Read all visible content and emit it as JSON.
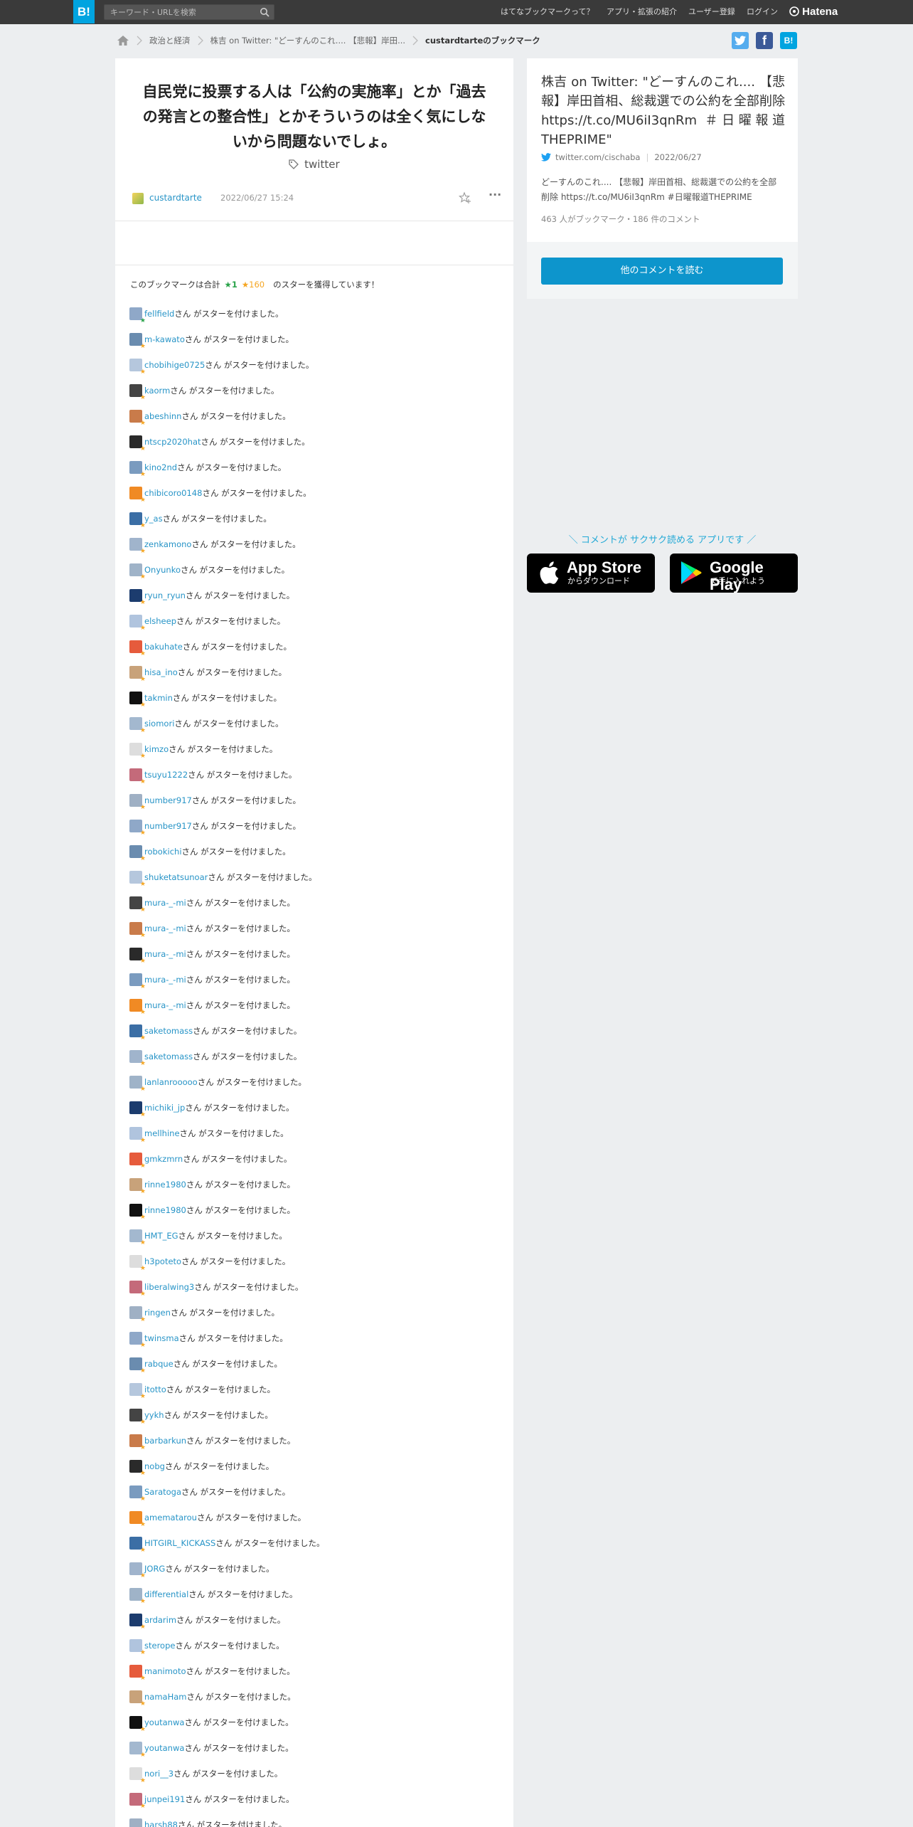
{
  "header": {
    "logo": "B!",
    "search_placeholder": "キーワード・URLを検索",
    "nav": [
      "はてなブックマークって？",
      "アプリ・拡張の紹介",
      "ユーザー登録",
      "ログイン"
    ],
    "brand": "Hatena"
  },
  "breadcrumb": {
    "items": [
      "政治と経済",
      "株吉 on Twitter: \"どーすんのこれ.... 【悲報】岸田...",
      "custardtarteのブックマーク"
    ]
  },
  "share": {
    "twitter": "twitter",
    "facebook": "f",
    "hatena": "B!"
  },
  "bookmark": {
    "comment": "自民党に投票する人は「公約の実施率」とか「過去の発言との整合性」とかそういうのは全く気にしないから問題ないでしょ。",
    "tag": "twitter",
    "user": "custardtarte",
    "date": "2022/06/27 15:24",
    "star_total_prefix": "このブックマークは合計",
    "green_stars": "1",
    "yellow_stars": "160",
    "star_total_suffix": "のスターを獲得しています！"
  },
  "star_suffix": "さん がスターを付けました。",
  "stars": [
    {
      "user": "fellfield",
      "green": true
    },
    {
      "user": "m-kawato"
    },
    {
      "user": "chobihige0725"
    },
    {
      "user": "kaorm"
    },
    {
      "user": "abeshinn"
    },
    {
      "user": "ntscp2020hat"
    },
    {
      "user": "kino2nd"
    },
    {
      "user": "chibicoro0148"
    },
    {
      "user": "y_as"
    },
    {
      "user": "zenkamono"
    },
    {
      "user": "Onyunko"
    },
    {
      "user": "ryun_ryun"
    },
    {
      "user": "elsheep"
    },
    {
      "user": "bakuhate"
    },
    {
      "user": "hisa_ino"
    },
    {
      "user": "takmin"
    },
    {
      "user": "siomori"
    },
    {
      "user": "kimzo"
    },
    {
      "user": "tsuyu1222"
    },
    {
      "user": "number917"
    },
    {
      "user": "number917"
    },
    {
      "user": "robokichi"
    },
    {
      "user": "shuketatsunoar"
    },
    {
      "user": "mura-_-mi"
    },
    {
      "user": "mura-_-mi"
    },
    {
      "user": "mura-_-mi"
    },
    {
      "user": "mura-_-mi"
    },
    {
      "user": "mura-_-mi"
    },
    {
      "user": "saketomass"
    },
    {
      "user": "saketomass"
    },
    {
      "user": "lanlanrooooo"
    },
    {
      "user": "michiki_jp"
    },
    {
      "user": "mellhine"
    },
    {
      "user": "gmkzmrn"
    },
    {
      "user": "rinne1980"
    },
    {
      "user": "rinne1980"
    },
    {
      "user": "HMT_EG"
    },
    {
      "user": "h3poteto"
    },
    {
      "user": "liberalwing3"
    },
    {
      "user": "ringen"
    },
    {
      "user": "twinsma"
    },
    {
      "user": "rabque"
    },
    {
      "user": "itotto"
    },
    {
      "user": "yykh"
    },
    {
      "user": "barbarkun"
    },
    {
      "user": "nobg"
    },
    {
      "user": "Saratoga"
    },
    {
      "user": "amematarou"
    },
    {
      "user": "HITGIRL_KICKASS"
    },
    {
      "user": "JORG"
    },
    {
      "user": "differential"
    },
    {
      "user": "ardarim"
    },
    {
      "user": "sterope"
    },
    {
      "user": "manimoto"
    },
    {
      "user": "namaHam"
    },
    {
      "user": "youtanwa"
    },
    {
      "user": "youtanwa"
    },
    {
      "user": "nori__3"
    },
    {
      "user": "junpei191"
    },
    {
      "user": "harsh88"
    }
  ],
  "entry": {
    "title": "株吉 on Twitter: \"どーすんのこれ.... 【悲報】岸田首相、総裁選での公約を全部削除 https://t.co/MU6iI3qnRm ＃日曜報道THEPRIME\"",
    "domain": "twitter.com/cischaba",
    "date": "2022/06/27",
    "description": "どーすんのこれ.... 【悲報】岸田首相、総裁選での公約を全部削除 https://t.co/MU6iI3qnRm #日曜報道THEPRIME",
    "count": "463 人がブックマーク・186 件のコメント",
    "read_button": "他のコメントを読む"
  },
  "app_promo": {
    "text": "＼ コメントが サクサク読める アプリです ／",
    "apple_main": "App Store",
    "apple_sub": "からダウンロード",
    "google_main": "Google Play",
    "google_sub": "で手に入れよう"
  },
  "colors": {
    "brand": "#01a4e0",
    "link": "#2794c7",
    "star_yellow": "#f5a623",
    "star_green": "#2aa34a",
    "button": "#0d95cc"
  }
}
